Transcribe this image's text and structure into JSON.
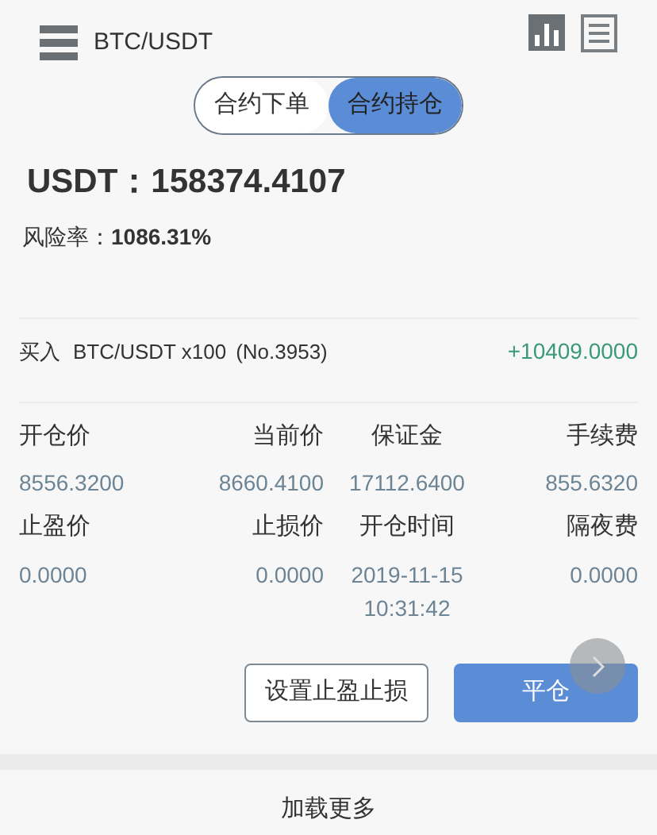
{
  "header": {
    "title": "BTC/USDT"
  },
  "tabs": [
    {
      "label": "合约下单",
      "selected": false
    },
    {
      "label": "合约持仓",
      "selected": true
    }
  ],
  "balance": "USDT：158374.4107",
  "risk": {
    "label": "风险率：",
    "value": "1086.31%"
  },
  "position": {
    "side": "买入",
    "symbol": "BTC/USDT x100",
    "number": "(No.3953)",
    "profit": "+10409.0000",
    "fields": [
      {
        "label": "开仓价",
        "value": "8556.3200"
      },
      {
        "label": "当前价",
        "value": "8660.4100"
      },
      {
        "label": "保证金",
        "value": "17112.6400"
      },
      {
        "label": "手续费",
        "value": "855.6320"
      },
      {
        "label": "止盈价",
        "value": "0.0000"
      },
      {
        "label": "止损价",
        "value": "0.0000"
      },
      {
        "label": "开仓时间",
        "value": "2019-11-15 10:31:42"
      },
      {
        "label": "隔夜费",
        "value": "0.0000"
      }
    ],
    "buttons": [
      {
        "label": "设置止盈止损",
        "kind": "outline"
      },
      {
        "label": "平仓",
        "kind": "primary"
      }
    ]
  },
  "load_more": "加载更多"
}
